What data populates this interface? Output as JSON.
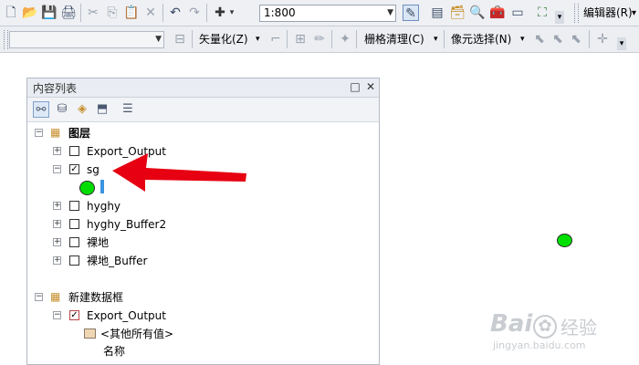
{
  "toolbar_main": {
    "scale_value": "1:800",
    "editor_label": "编辑器(R)",
    "editor_arrow": "▾",
    "icons": [
      "new-document-icon",
      "open-folder-icon",
      "save-icon",
      "print-icon",
      "cut-icon",
      "copy-icon",
      "paste-icon",
      "delete-icon",
      "undo-icon",
      "redo-icon",
      "add-data-icon",
      "editor-toolbar-icon",
      "table-window-icon",
      "catalog-icon",
      "search-icon",
      "arctoolbox-icon",
      "python-window-icon",
      "model-builder-icon"
    ]
  },
  "toolbar_second": {
    "vectorize_label": "矢量化(Z)",
    "raster_cleanup_label": "栅格清理(C)",
    "cell_selection_label": "像元选择(N)",
    "dropdown_arrow": "▾"
  },
  "toc": {
    "title": "内容列表",
    "pin_glyph": "□",
    "close_glyph": "✕",
    "tools": [
      "list-by-drawing-order-icon",
      "list-by-source-icon",
      "list-by-visibility-icon",
      "list-by-selection-icon",
      "options-icon"
    ],
    "frame1": {
      "label": "图层",
      "layers": [
        {
          "name": "Export_Output",
          "checked": false,
          "expanded": false
        },
        {
          "name": "sg",
          "checked": true,
          "expanded": true
        },
        {
          "name": "hyghy",
          "checked": false,
          "expanded": false
        },
        {
          "name": "hyghy_Buffer2",
          "checked": false,
          "expanded": false
        },
        {
          "name": "裸地",
          "checked": false,
          "expanded": false
        },
        {
          "name": "裸地_Buffer",
          "checked": false,
          "expanded": false
        }
      ]
    },
    "frame2": {
      "label": "新建数据框",
      "layer": {
        "name": "Export_Output",
        "checked": true,
        "expanded": true
      },
      "legend_other": "<其他所有值>",
      "legend_field": "名称"
    }
  },
  "colors": {
    "point_symbol": "#00e000",
    "arrow": "#e60012",
    "cursor_bar": "#3b95e0"
  },
  "watermark": {
    "brand": "Bai",
    "brand_suffix": "经验",
    "url": "jingyan.baidu.com"
  }
}
